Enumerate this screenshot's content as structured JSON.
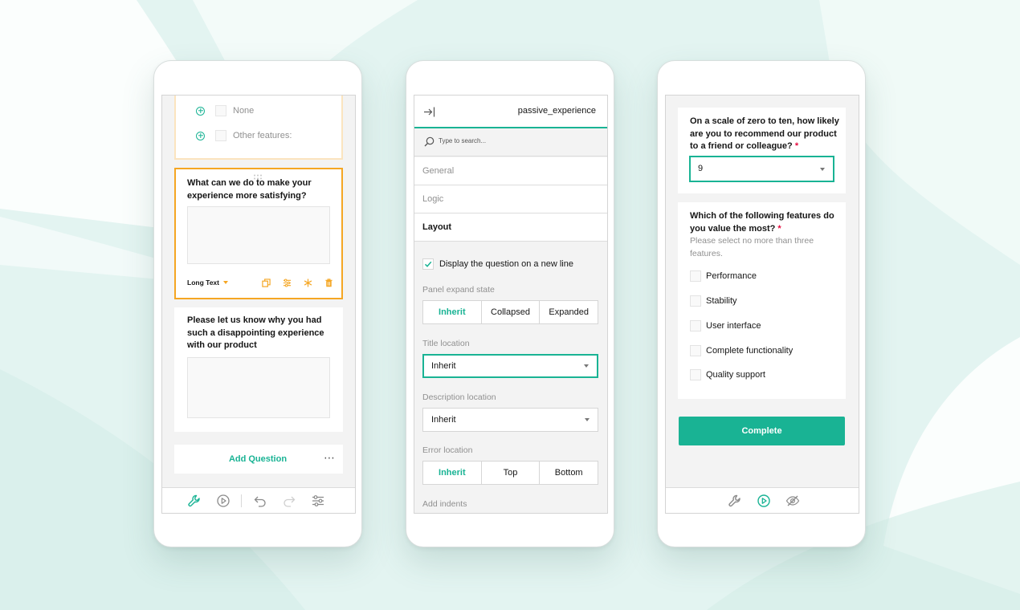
{
  "colors": {
    "accent": "#19b394",
    "selection": "#f5a623",
    "required": "#e60a3e",
    "background": "#e3f4f1"
  },
  "designer": {
    "choices": [
      {
        "label": "None"
      },
      {
        "label": "Other features:"
      }
    ],
    "question_1": {
      "title_line1": "What can we do to make your",
      "title_line2": "experience more satisfying?",
      "type_label": "Long Text"
    },
    "question_2": {
      "title_line1": "Please let us know why you had",
      "title_line2": "such a disappointing experience",
      "title_line3": "with our product"
    },
    "add_question_label": "Add Question",
    "more_label": "⋯",
    "toolbar_icons": [
      "wrench-icon",
      "play-icon",
      "undo-icon",
      "redo-icon",
      "settings-icon"
    ]
  },
  "property_grid": {
    "object_name": "passive_experience",
    "search_placeholder": "Type to search...",
    "categories": [
      "General",
      "Logic",
      "Layout"
    ],
    "new_line_checkbox_label": "Display the question on a new line",
    "panel_expand_state": {
      "label": "Panel expand state",
      "options": [
        "Inherit",
        "Collapsed",
        "Expanded"
      ],
      "selected": "Inherit"
    },
    "title_location": {
      "label": "Title location",
      "value": "Inherit"
    },
    "description_location": {
      "label": "Description location",
      "value": "Inherit"
    },
    "error_location": {
      "label": "Error location",
      "options": [
        "Inherit",
        "Top",
        "Bottom"
      ],
      "selected": "Inherit"
    },
    "add_indents_label": "Add indents"
  },
  "preview": {
    "nps_question": {
      "line1": "On a scale of zero to ten, how likely",
      "line2": "are you to recommend our product",
      "line3": "to a friend or colleague?",
      "required_mark": "*",
      "value": "9"
    },
    "features_question": {
      "line1": "Which of the following features do",
      "line2": "you value the most?",
      "required_mark": "*",
      "desc_line1": "Please select no more than three",
      "desc_line2": "features.",
      "options": [
        "Performance",
        "Stability",
        "User interface",
        "Complete functionality",
        "Quality support"
      ]
    },
    "complete_label": "Complete",
    "toolbar_icons": [
      "wrench-icon",
      "play-icon",
      "hide-icon"
    ]
  }
}
